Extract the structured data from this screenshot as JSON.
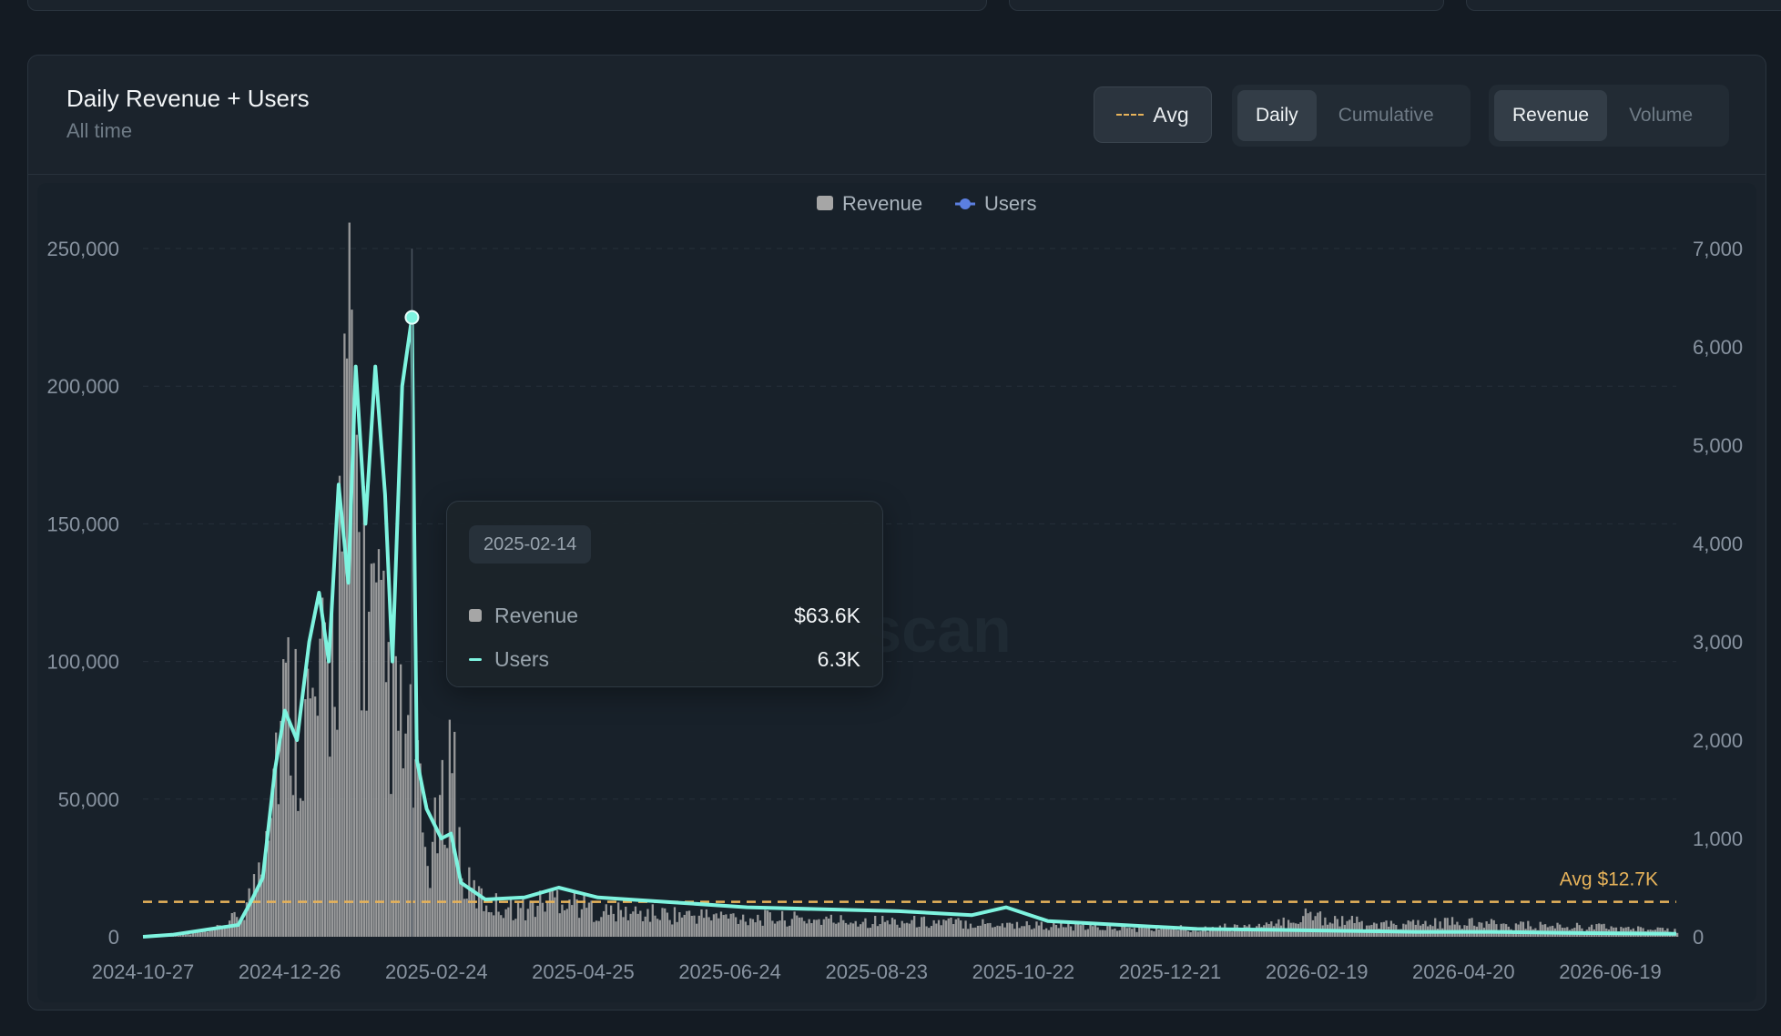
{
  "panel": {
    "title": "Daily Revenue + Users",
    "subtitle": "All time",
    "avg_toggle_label": "Avg",
    "period_options": [
      {
        "label": "Daily",
        "active": true
      },
      {
        "label": "Cumulative",
        "active": false
      }
    ],
    "metric_options": [
      {
        "label": "Revenue",
        "active": true
      },
      {
        "label": "Volume",
        "active": false
      }
    ]
  },
  "watermark": "scan",
  "tooltip": {
    "date": "2025-02-14",
    "rows": [
      {
        "label": "Revenue",
        "value": "$63.6K"
      },
      {
        "label": "Users",
        "value": "6.3K"
      }
    ]
  },
  "colors": {
    "revenue": "#a6a6a6",
    "users": "#7ef3df",
    "users_legend": "#5b7fe0",
    "avg_line": "#e7b35a"
  },
  "chart_data": {
    "type": "bar",
    "legend": [
      "Revenue",
      "Users"
    ],
    "legend_placement": "top-center",
    "grid": true,
    "x_ticks": [
      "2024-10-27",
      "2024-12-26",
      "2025-02-24",
      "2025-04-25",
      "2025-06-24",
      "2025-08-23",
      "2025-10-22",
      "2025-12-21",
      "2026-02-19",
      "2026-04-20",
      "2026-06-19"
    ],
    "y_left_ticks": [
      "0",
      "50,000",
      "100,000",
      "150,000",
      "200,000",
      "250,000"
    ],
    "y_right_ticks": [
      "0",
      "1,000",
      "2,000",
      "3,000",
      "4,000",
      "5,000",
      "6,000",
      "7,000"
    ],
    "ylim_left": [
      0,
      250000
    ],
    "ylim_right": [
      0,
      7000
    ],
    "x_range": [
      "2024-10-27",
      "2026-07-16"
    ],
    "avg_revenue": 12700,
    "avg_label": "Avg $12.7K",
    "highlight": {
      "date": "2025-02-14",
      "revenue": 63600,
      "users": 6300
    },
    "series": [
      {
        "name": "Revenue",
        "kind": "bar",
        "axis": "left",
        "points": [
          [
            "2024-10-27",
            0
          ],
          [
            "2024-11-10",
            500
          ],
          [
            "2024-11-24",
            2000
          ],
          [
            "2024-12-06",
            8000
          ],
          [
            "2024-12-12",
            20000
          ],
          [
            "2024-12-18",
            60000
          ],
          [
            "2024-12-24",
            85000
          ],
          [
            "2024-12-30",
            80000
          ],
          [
            "2025-01-05",
            78000
          ],
          [
            "2025-01-11",
            95000
          ],
          [
            "2025-01-17",
            160000
          ],
          [
            "2025-01-20",
            205000
          ],
          [
            "2025-01-23",
            140000
          ],
          [
            "2025-01-27",
            115000
          ],
          [
            "2025-02-02",
            95000
          ],
          [
            "2025-02-08",
            75000
          ],
          [
            "2025-02-14",
            63600
          ],
          [
            "2025-02-20",
            25000
          ],
          [
            "2025-02-26",
            45000
          ],
          [
            "2025-03-02",
            72000
          ],
          [
            "2025-03-06",
            20000
          ],
          [
            "2025-03-16",
            12000
          ],
          [
            "2025-04-01",
            10000
          ],
          [
            "2025-04-15",
            15000
          ],
          [
            "2025-05-01",
            9000
          ],
          [
            "2025-06-01",
            8000
          ],
          [
            "2025-07-01",
            7000
          ],
          [
            "2025-08-01",
            6000
          ],
          [
            "2025-09-01",
            5500
          ],
          [
            "2025-10-01",
            5000
          ],
          [
            "2025-11-01",
            4000
          ],
          [
            "2025-12-01",
            3000
          ],
          [
            "2026-01-01",
            3000
          ],
          [
            "2026-02-01",
            4000
          ],
          [
            "2026-02-15",
            8000
          ],
          [
            "2026-03-15",
            4000
          ],
          [
            "2026-04-15",
            5000
          ],
          [
            "2026-05-15",
            4000
          ],
          [
            "2026-06-15",
            3500
          ],
          [
            "2026-07-16",
            2000
          ]
        ]
      },
      {
        "name": "Users",
        "kind": "line",
        "axis": "right",
        "points": [
          [
            "2024-10-27",
            0
          ],
          [
            "2024-11-08",
            20
          ],
          [
            "2024-11-24",
            80
          ],
          [
            "2024-12-05",
            120
          ],
          [
            "2024-12-10",
            350
          ],
          [
            "2024-12-15",
            600
          ],
          [
            "2024-12-20",
            1700
          ],
          [
            "2024-12-24",
            2300
          ],
          [
            "2024-12-29",
            2000
          ],
          [
            "2025-01-03",
            3000
          ],
          [
            "2025-01-07",
            3500
          ],
          [
            "2025-01-11",
            2800
          ],
          [
            "2025-01-15",
            4600
          ],
          [
            "2025-01-19",
            3600
          ],
          [
            "2025-01-22",
            5800
          ],
          [
            "2025-01-26",
            4200
          ],
          [
            "2025-01-30",
            5800
          ],
          [
            "2025-02-03",
            4500
          ],
          [
            "2025-02-06",
            2800
          ],
          [
            "2025-02-10",
            5600
          ],
          [
            "2025-02-14",
            6300
          ],
          [
            "2025-02-16",
            1800
          ],
          [
            "2025-02-20",
            1300
          ],
          [
            "2025-02-26",
            1000
          ],
          [
            "2025-03-02",
            1050
          ],
          [
            "2025-03-06",
            550
          ],
          [
            "2025-03-16",
            380
          ],
          [
            "2025-04-01",
            400
          ],
          [
            "2025-04-15",
            500
          ],
          [
            "2025-05-01",
            400
          ],
          [
            "2025-06-01",
            350
          ],
          [
            "2025-07-01",
            300
          ],
          [
            "2025-08-01",
            280
          ],
          [
            "2025-09-01",
            260
          ],
          [
            "2025-10-01",
            220
          ],
          [
            "2025-10-15",
            300
          ],
          [
            "2025-11-01",
            160
          ],
          [
            "2025-12-01",
            120
          ],
          [
            "2026-01-01",
            80
          ],
          [
            "2026-02-01",
            70
          ],
          [
            "2026-03-01",
            60
          ],
          [
            "2026-04-01",
            50
          ],
          [
            "2026-05-01",
            50
          ],
          [
            "2026-06-01",
            40
          ],
          [
            "2026-07-16",
            30
          ]
        ]
      }
    ]
  }
}
